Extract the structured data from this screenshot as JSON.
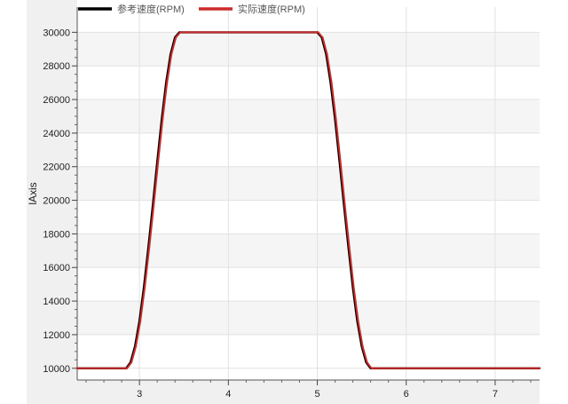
{
  "chart_data": {
    "type": "line",
    "ylabel": "lAxis",
    "xlim": [
      2.3,
      7.5
    ],
    "ylim": [
      9300,
      31500
    ],
    "x_ticks": [
      3,
      4,
      5,
      6,
      7
    ],
    "y_ticks": [
      10000,
      12000,
      14000,
      16000,
      18000,
      20000,
      22000,
      24000,
      26000,
      28000,
      30000
    ],
    "grid": true,
    "legend_position": "top-left",
    "series": [
      {
        "name": "参考速度(RPM)",
        "color": "#000000",
        "x": [
          2.3,
          2.85,
          2.9,
          2.95,
          3.0,
          3.05,
          3.1,
          3.15,
          3.2,
          3.25,
          3.3,
          3.35,
          3.4,
          3.45,
          5.0,
          5.05,
          5.1,
          5.15,
          5.2,
          5.25,
          5.3,
          5.35,
          5.4,
          5.45,
          5.5,
          5.55,
          5.6,
          7.5
        ],
        "y": [
          10000,
          10000,
          10350,
          11300,
          12800,
          14800,
          17200,
          19700,
          22300,
          24800,
          27000,
          28700,
          29700,
          30000,
          30000,
          29700,
          28700,
          27000,
          24800,
          22300,
          19700,
          17200,
          14800,
          12800,
          11300,
          10350,
          10000,
          10000
        ]
      },
      {
        "name": "实际速度(RPM)",
        "color": "#cc2b2b",
        "x": [
          2.3,
          2.86,
          2.91,
          2.96,
          3.01,
          3.06,
          3.11,
          3.16,
          3.21,
          3.26,
          3.31,
          3.36,
          3.41,
          3.46,
          5.01,
          5.06,
          5.11,
          5.16,
          5.21,
          5.26,
          5.31,
          5.36,
          5.41,
          5.46,
          5.51,
          5.56,
          5.61,
          7.5
        ],
        "y": [
          10000,
          10000,
          10350,
          11300,
          12800,
          14800,
          17200,
          19700,
          22300,
          24800,
          27000,
          28700,
          29700,
          30000,
          30000,
          29700,
          28700,
          27000,
          24800,
          22300,
          19700,
          17200,
          14800,
          12800,
          11300,
          10350,
          10000,
          10000
        ]
      }
    ]
  }
}
